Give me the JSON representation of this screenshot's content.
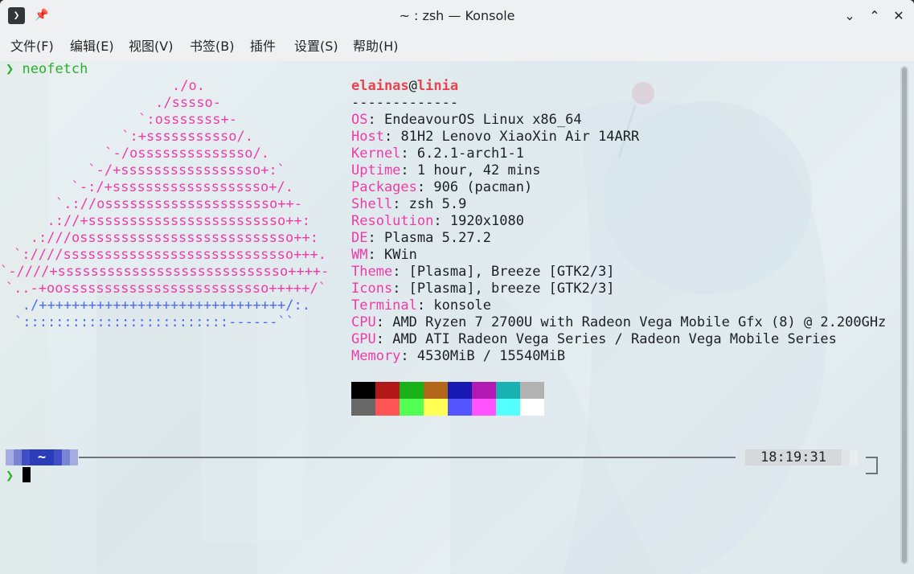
{
  "window": {
    "title": "~ : zsh — Konsole",
    "app_icon": "terminal-icon",
    "pin_icon": "pin-icon",
    "buttons": {
      "minimize": "chevron-down-icon",
      "maximize": "chevron-up-icon",
      "close": "close-icon"
    }
  },
  "menu": [
    "文件(F)",
    "编辑(E)",
    "视图(V)",
    "书签(B)",
    "插件",
    "设置(S)",
    "帮助(H)"
  ],
  "terminal": {
    "prompt_symbol": "❯",
    "command": "neofetch",
    "logo": [
      {
        "p": "./o.",
        "b": ""
      },
      {
        "p": "./sssso-",
        "b": ""
      },
      {
        "p": "`:osssssss+-",
        "b": ""
      },
      {
        "p": "`:+sssssssssso/.",
        "b": ""
      },
      {
        "p": "`-/ossssssssssssso/.",
        "b": ""
      },
      {
        "p": "`-/+sssssssssssssssso+:`",
        "b": ""
      },
      {
        "p": "`-:/+sssssssssssssssssso+/.",
        "b": ""
      },
      {
        "p": "`.://osssssssssssssssssssso++-",
        "b": ""
      },
      {
        "p": ".://+ssssssssssssssssssssssso++:",
        "b": ""
      },
      {
        "p": ".:///ossssssssssssssssssssssssso++:",
        "b": ""
      },
      {
        "p": "`:////ssssssssssssssssssssssssssso+++.",
        "b": ""
      },
      {
        "p": "`-////+ssssssssssssssssssssssssssso++++-",
        "b": ""
      },
      {
        "p": "`..-+oosssssssssssssssssssssssso+++++/`",
        "b": ""
      },
      {
        "p": "",
        "b": "./++++++++++++++++++++++++++++++/:."
      },
      {
        "p": "",
        "b": "`:::::::::::::::::::::::::------``"
      }
    ],
    "user": "elainas",
    "at": "@",
    "host": "linia",
    "separator": "-------------",
    "info": [
      {
        "label": "OS",
        "value": "EndeavourOS Linux x86_64"
      },
      {
        "label": "Host",
        "value": "81H2 Lenovo XiaoXin Air 14ARR"
      },
      {
        "label": "Kernel",
        "value": "6.2.1-arch1-1"
      },
      {
        "label": "Uptime",
        "value": "1 hour, 42 mins"
      },
      {
        "label": "Packages",
        "value": "906 (pacman)"
      },
      {
        "label": "Shell",
        "value": "zsh 5.9"
      },
      {
        "label": "Resolution",
        "value": "1920x1080"
      },
      {
        "label": "DE",
        "value": "Plasma 5.27.2"
      },
      {
        "label": "WM",
        "value": "KWin"
      },
      {
        "label": "Theme",
        "value": "[Plasma], Breeze [GTK2/3]"
      },
      {
        "label": "Icons",
        "value": "[Plasma], breeze [GTK2/3]"
      },
      {
        "label": "Terminal",
        "value": "konsole"
      },
      {
        "label": "CPU",
        "value": "AMD Ryzen 7 2700U with Radeon Vega Mobile Gfx (8) @ 2.200GHz"
      },
      {
        "label": "GPU",
        "value": "AMD ATI Radeon Vega Series / Radeon Vega Mobile Series"
      },
      {
        "label": "Memory",
        "value": "4530MiB / 15540MiB"
      }
    ],
    "palette_top": [
      "#000000",
      "#b21818",
      "#18b218",
      "#b26818",
      "#1818b2",
      "#b218b2",
      "#18b2b2",
      "#b2b2b2"
    ],
    "palette_bottom": [
      "#686868",
      "#ff5454",
      "#54ff54",
      "#ffff54",
      "#5454ff",
      "#ff54ff",
      "#54ffff",
      "#ffffff"
    ],
    "status": {
      "dir": "~",
      "time": "18:19:31"
    }
  }
}
